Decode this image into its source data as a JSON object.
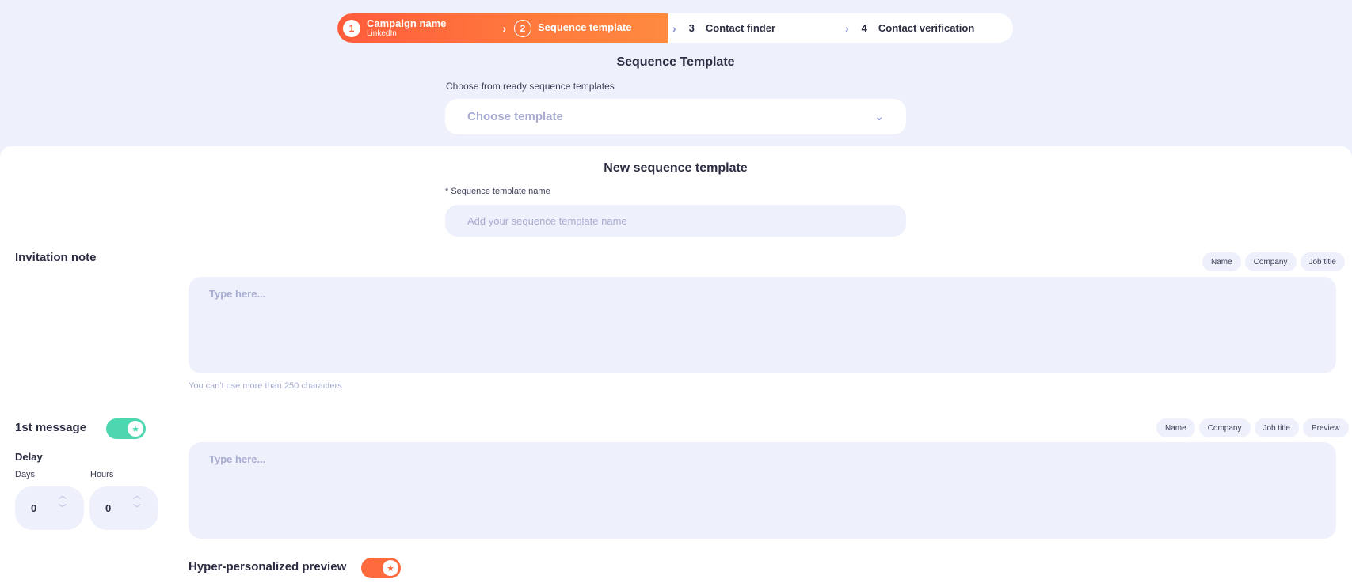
{
  "stepper": {
    "steps": [
      {
        "num": "1",
        "label": "Campaign name",
        "sub": "LinkedIn"
      },
      {
        "num": "2",
        "label": "Sequence template"
      },
      {
        "num": "3",
        "label": "Contact finder"
      },
      {
        "num": "4",
        "label": "Contact verification"
      }
    ]
  },
  "template_section": {
    "title": "Sequence Template",
    "choose_label": "Choose from ready sequence templates",
    "dropdown_placeholder": "Choose template"
  },
  "new_template": {
    "title": "New sequence template",
    "name_label": "* Sequence template name",
    "name_placeholder": "Add your sequence template name"
  },
  "invitation": {
    "label": "Invitation note",
    "chips": [
      "Name",
      "Company",
      "Job title"
    ],
    "placeholder": "Type here...",
    "hint": "You can't use more than 250 characters"
  },
  "first_message": {
    "label": "1st message",
    "chips": [
      "Name",
      "Company",
      "Job title",
      "Preview"
    ],
    "placeholder": "Type here...",
    "delay_label": "Delay",
    "days_label": "Days",
    "hours_label": "Hours",
    "days_value": "0",
    "hours_value": "0"
  },
  "preview": {
    "label": "Hyper-personalized preview"
  },
  "colors": {
    "accent_orange": "#ff6b3d",
    "toggle_green": "#4dd6b0",
    "background": "#eef0fc"
  }
}
